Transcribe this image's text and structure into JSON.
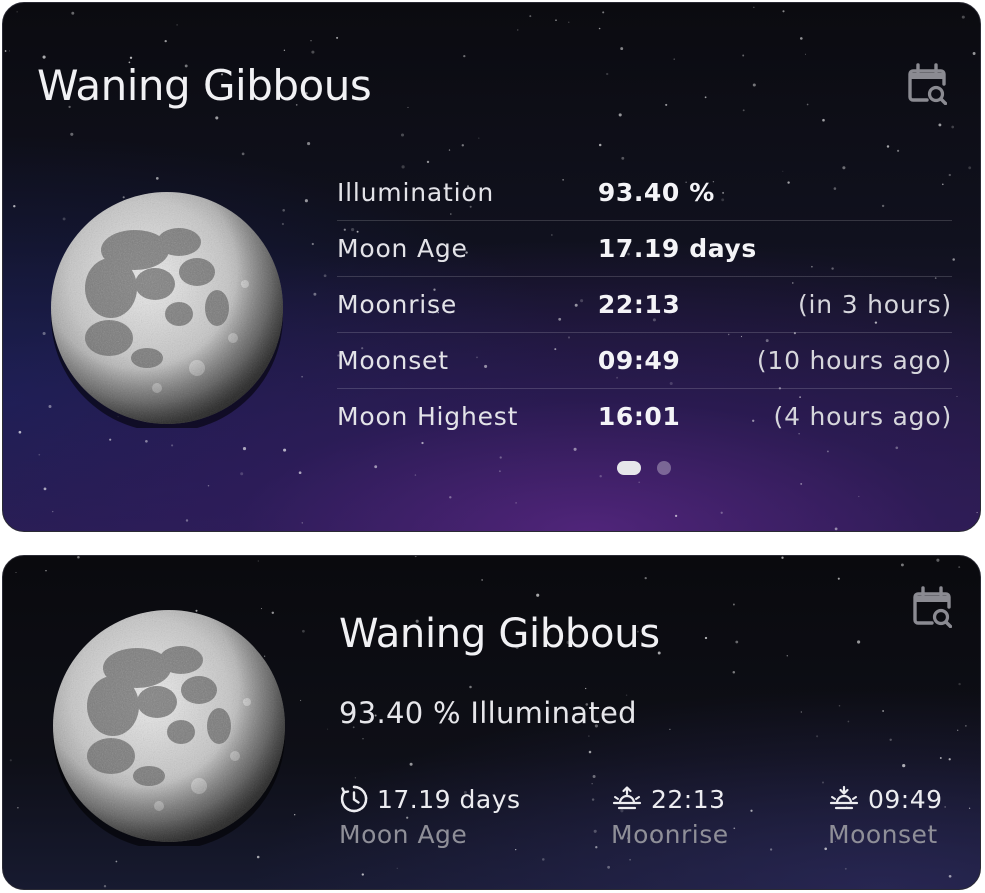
{
  "widget_large": {
    "phase_name": "Waning Gibbous",
    "calendar_icon": "calendar-search-icon",
    "rows": [
      {
        "label": "Illumination",
        "value": "93.40 %",
        "relative": ""
      },
      {
        "label": "Moon Age",
        "value": "17.19 days",
        "relative": ""
      },
      {
        "label": "Moonrise",
        "value": "22:13",
        "relative": "(in 3 hours)"
      },
      {
        "label": "Moonset",
        "value": "09:49",
        "relative": "(10 hours ago)"
      },
      {
        "label": "Moon Highest",
        "value": "16:01",
        "relative": "(4 hours ago)"
      }
    ],
    "pager": {
      "pages": 2,
      "current": 1
    }
  },
  "widget_medium": {
    "phase_name": "Waning Gibbous",
    "illumination_text": "93.40 % Illuminated",
    "calendar_icon": "calendar-search-icon",
    "stats": [
      {
        "icon": "clock-icon",
        "value": "17.19 days",
        "caption": "Moon Age"
      },
      {
        "icon": "moonrise-icon",
        "value": "22:13",
        "caption": "Moonrise"
      },
      {
        "icon": "moonset-icon",
        "value": "09:49",
        "caption": "Moonset"
      }
    ]
  },
  "colors": {
    "text_primary": "#f1f1f4",
    "text_secondary": "#8f8f98",
    "icon": "#8b8b92",
    "dot_active": "#e6e6ea"
  }
}
